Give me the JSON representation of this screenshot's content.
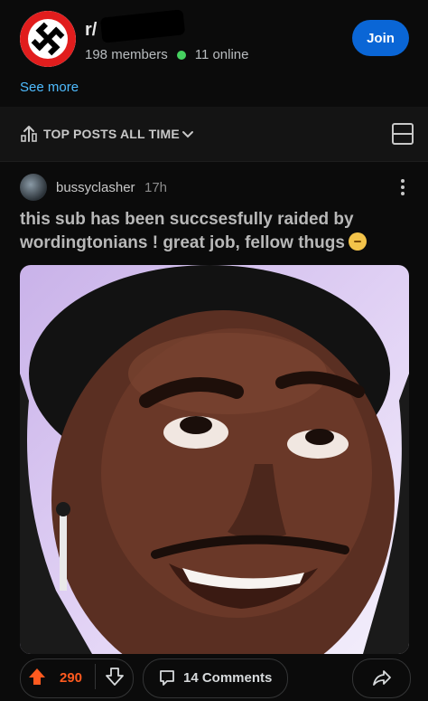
{
  "community": {
    "name": "r/",
    "members": "198 members",
    "online": "11 online",
    "join_label": "Join",
    "see_more": "See more",
    "avatar_icon": "community-avatar-icon"
  },
  "feed": {
    "sort_label": "TOP POSTS ALL TIME",
    "sort_icon": "top-posts-icon",
    "view_icon": "card-view-icon"
  },
  "post": {
    "author": "bussyclasher",
    "time": "17h",
    "title": "this sub has been succsesfully raided by wordingtonians ! great job, fellow thugs",
    "emoji": "smirking-face-emoji",
    "votes": "290",
    "comments": "14 Comments"
  },
  "colors": {
    "join_button": "#0a66d6",
    "link": "#4fbcff",
    "online_dot": "#46d160",
    "upvote": "#ff5a1f",
    "background": "#0b0b0b"
  }
}
